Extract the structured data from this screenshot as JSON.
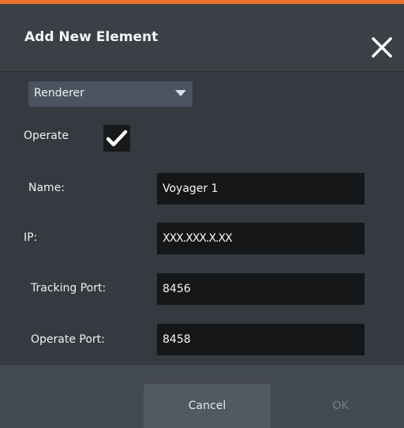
{
  "dialog": {
    "title": "Add New Element",
    "accent_color": "#e9732b",
    "close_icon": "close-icon"
  },
  "form": {
    "type_select": {
      "value": "Renderer",
      "icon": "dropdown-arrow-icon"
    },
    "operate": {
      "label": "Operate",
      "checked": true,
      "icon": "checkmark-icon"
    },
    "fields": [
      {
        "label": "Name:",
        "value": "Voyager 1"
      },
      {
        "label": "IP:",
        "value": "XXX.XXX.X.XX"
      },
      {
        "label": "Tracking Port:",
        "value": "8456"
      },
      {
        "label": "Operate Port:",
        "value": "8458"
      }
    ]
  },
  "footer": {
    "cancel_label": "Cancel",
    "ok_label": "OK",
    "ok_enabled": false
  }
}
